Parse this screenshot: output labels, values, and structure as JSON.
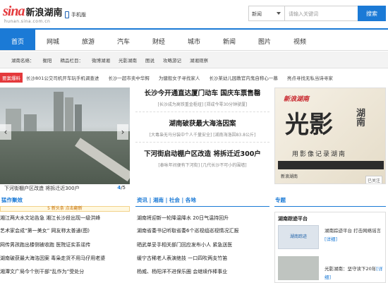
{
  "header": {
    "logo_brand": "sina",
    "logo_text": "新浪湖南",
    "domain": "hunan.sina.com.cn",
    "mobile_label": "手机版"
  },
  "search": {
    "select_value": "新闻",
    "placeholder": "请输入关键词",
    "button_label": "搜索"
  },
  "nav": {
    "items": [
      "首页",
      "网城",
      "旅游",
      "汽车",
      "财经",
      "城市",
      "新闻",
      "图片",
      "视频"
    ],
    "active": "首页"
  },
  "subnav": {
    "label": "湖南名络：",
    "items": [
      "衡阳",
      "精品栏目：",
      "微博湖湘",
      "光影湖南",
      "图说",
      "攻略游记",
      "湖湘观察"
    ]
  },
  "hot": {
    "tag": "要案爆料",
    "items": [
      "长沙801公交司机开车玩手机调查进",
      "长沙一超市卖中华鳄",
      "为健般女子寻找家人",
      "长沙某幼儿园教官内鬼自称心一慕",
      "亮点寻找无私当诗寻家"
    ]
  },
  "slideshow": {
    "caption": "下河街棚户区改造 将拆迁近300户",
    "page_current": "4",
    "page_total": "/5",
    "prev_icon": "chevron-left-icon",
    "next_icon": "chevron-right-icon"
  },
  "headlines": [
    {
      "title": "长沙今开通直达厦门动车 国庆车票售罄",
      "sub": "[长沙成为高铁重金枢纽] [郑成今零30分钟驶厦]"
    },
    {
      "title": "湖南破获最大海洛因案",
      "sub": "[大毒枭无马分装中个人千量安全] [湖南海洛因83.8公斤]"
    },
    {
      "title": "下河街启动棚户区改造 将拆迁近300户",
      "sub": "[泰咏年间便有下河街] [几代长沙不可小的围墙]"
    }
  ],
  "ad": {
    "brand": "新浪湖南",
    "big_text": "光影",
    "side_text": "湖南",
    "slogan": "用影像记录湖南",
    "footer": "新浪湖南",
    "close": "已关注"
  },
  "sections": {
    "left_title": "猛作聚效",
    "left_fold": "5 新头条 点击翻新",
    "left_list": [
      "湘江两大水文站告急 湘江长沙段出现一级洪峰",
      "艺术家会成“第一美女” 网友称太普通(图)",
      "网传男孩跑出楼侧被收跑 医院证实系谣传",
      "湖南破获最大海洛因案 毒枭走货不用马仔用老婆",
      "湘潭文广局今个别干部“乱作为”受处分"
    ],
    "mid_title": "资讯 | 湘南 | 社会 | 各地",
    "mid_list": [
      "湖南将迎新一轮降温降水 20日气温持回升",
      "湖南省委书记听取省委6个巡视组巡视情况汇报",
      "晒武单妥手相关部门回应发布小人 紧急送医",
      "缓宁古稀老人表演绝技 一口四吹两支竹笛",
      "杨威、杨阳洋不进保乐圈 会继续作棒事业"
    ],
    "right_title": "专题"
  },
  "topic_box": {
    "title": "湖南踪迹平台",
    "pic1_label": "湖南踪迹",
    "text1": "湖南踪迹平台 打击网络谣言",
    "detail1": "[详细]",
    "text2": "光影湖南：坚守读下20年",
    "detail2": "[详细]"
  }
}
